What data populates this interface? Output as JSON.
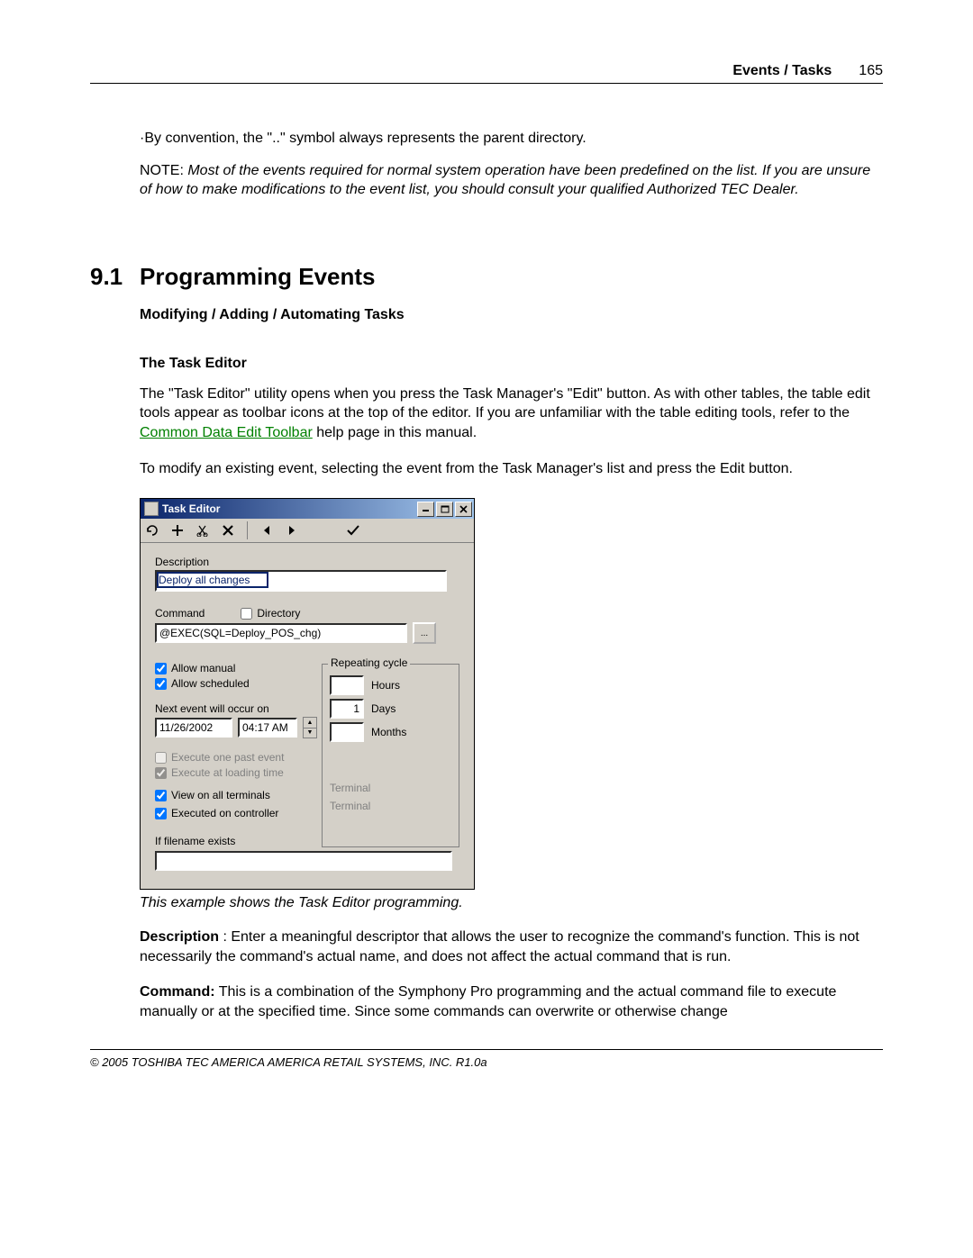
{
  "header": {
    "title": "Events / Tasks",
    "page": "165"
  },
  "intro": {
    "bullet": "·By convention, the \"..\" symbol always represents the parent directory.",
    "note_label": "NOTE: ",
    "note_body": "Most of the events required for normal system operation have been predefined on the list. If you are unsure of how to make modifications to the event list, you should consult your qualified Authorized TEC Dealer."
  },
  "section": {
    "num": "9.1",
    "title": "Programming Events",
    "sub1": "Modifying / Adding / Automating Tasks",
    "sub2": "The Task Editor"
  },
  "para1a": " The \"Task Editor\" utility opens when you press the Task Manager's \"Edit\" button. As with other tables, the table edit tools appear as toolbar icons at the top of the editor. If you are unfamiliar with the table editing tools, refer to the ",
  "para1_link": "Common Data Edit Toolbar",
  "para1b": " help page in this manual.",
  "para2": " To modify an existing event, selecting the event from the Task Manager's list and press the Edit button.",
  "editor": {
    "title": "Task Editor",
    "labels": {
      "description": "Description",
      "command": "Command",
      "directory": "Directory",
      "allow_manual": "Allow manual",
      "allow_scheduled": "Allow scheduled",
      "next_event": "Next event will occur on",
      "exec_past": "Execute one past event",
      "exec_loading": "Execute at loading time",
      "view_terminals": "View on all terminals",
      "exec_controller": "Executed on controller",
      "terminal": "Terminal",
      "if_filename": "If filename exists",
      "repeating": "Repeating cycle",
      "hours": "Hours",
      "days": "Days",
      "months": "Months"
    },
    "values": {
      "description": "Deploy all changes",
      "command": "@EXEC(SQL=Deploy_POS_chg)",
      "date": "11/26/2002",
      "time": "04:17 AM",
      "days": "1",
      "hours": "",
      "months": "",
      "filename": ""
    },
    "checks": {
      "directory": false,
      "allow_manual": true,
      "allow_scheduled": true,
      "exec_past": false,
      "exec_loading": true,
      "view_terminals": true,
      "exec_controller": true
    }
  },
  "caption": "This example shows the Task Editor programming.",
  "desc_para_label": "Description",
  "desc_para": " : Enter a meaningful descriptor that allows the user to recognize the command's function. This is not necessarily the command's actual name, and does not affect the actual command that is run.",
  "cmd_para_label": "Command:",
  "cmd_para": "  This is a combination of the Symphony Pro programming and the actual command file to execute manually or at the specified time. Since some commands can overwrite or otherwise change",
  "footer": "© 2005 TOSHIBA TEC AMERICA AMERICA RETAIL SYSTEMS, INC.   R1.0a"
}
